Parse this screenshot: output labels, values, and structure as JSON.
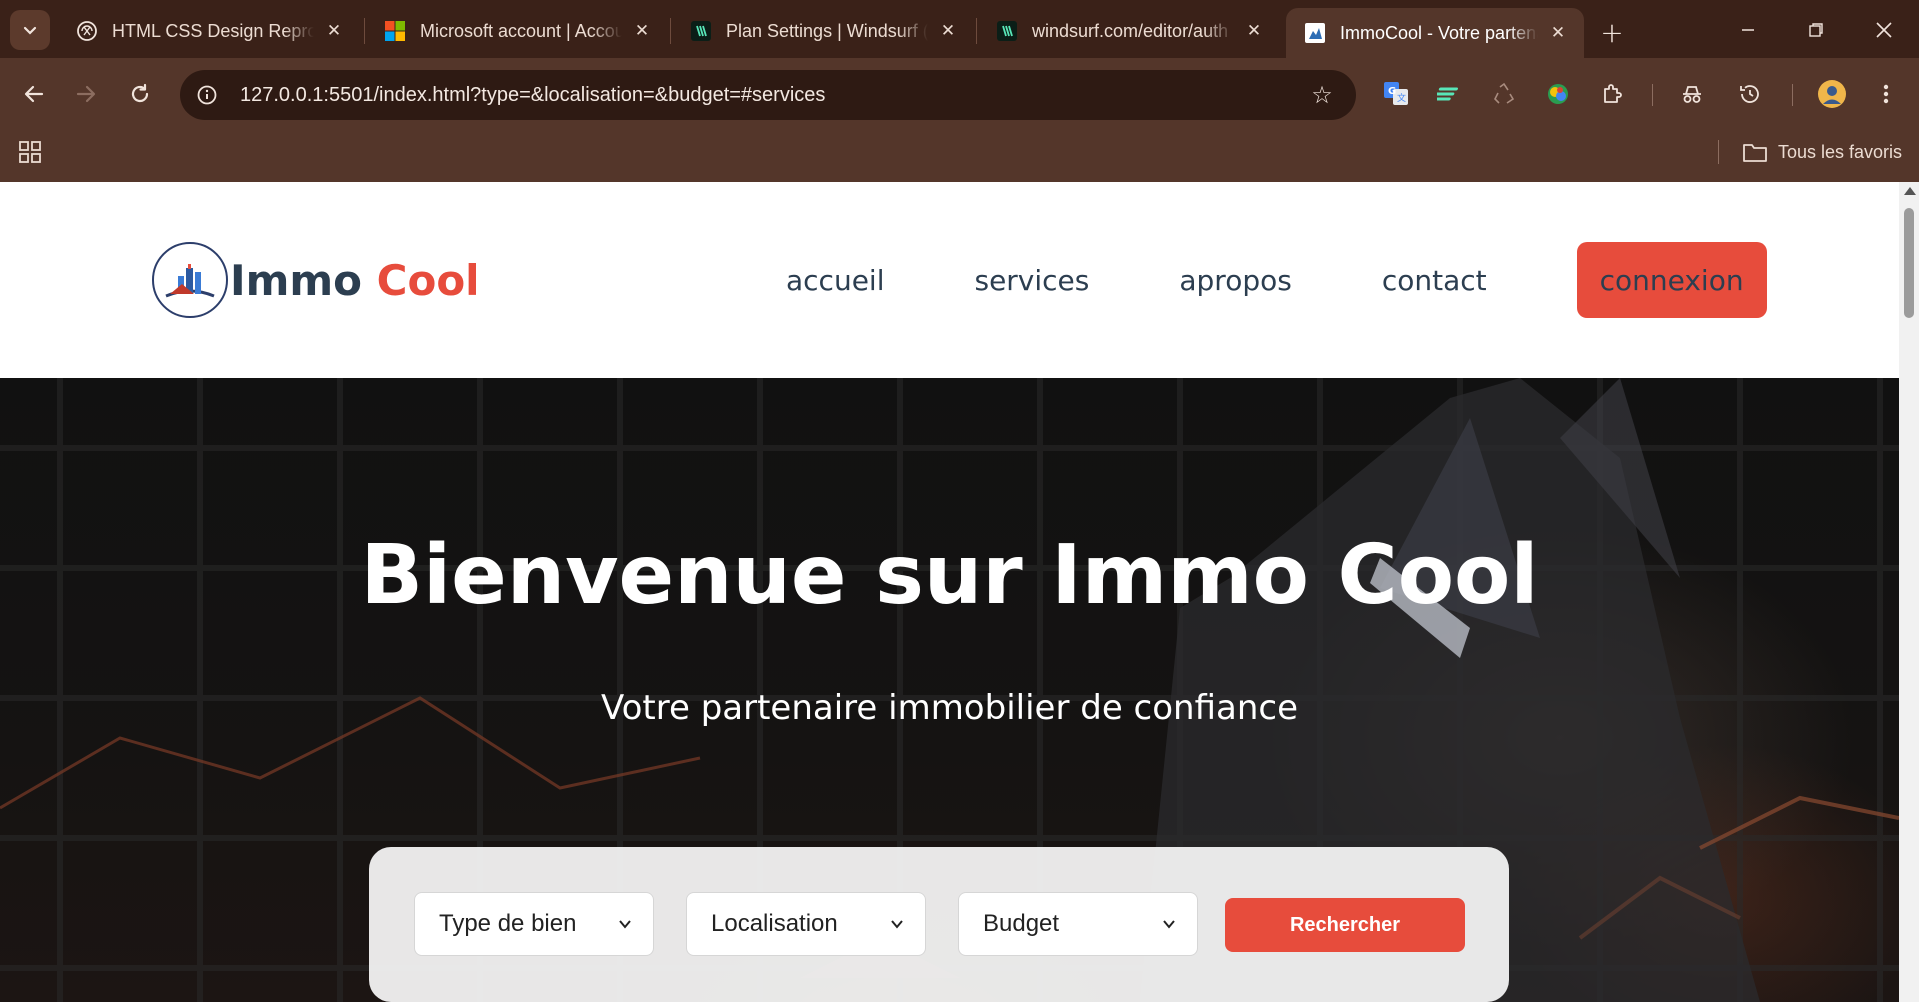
{
  "browser": {
    "tabs": [
      {
        "title": "HTML CSS Design Reproduction",
        "icon": "openai-icon"
      },
      {
        "title": "Microsoft account | Account",
        "icon": "microsoft-icon"
      },
      {
        "title": "Plan Settings | Windsurf (formerly Codeium)",
        "icon": "windsurf-icon"
      },
      {
        "title": "windsurf.com/editor/auth",
        "icon": "windsurf-icon"
      },
      {
        "title": "ImmoCool - Votre partenaire immobilier",
        "icon": "immocool-icon",
        "active": true
      }
    ],
    "url": "127.0.0.1:5501/index.html?type=&localisation=&budget=#services",
    "bookmarks_all_label": "Tous les favoris"
  },
  "site": {
    "logo": {
      "part1": "Immo ",
      "part2": "Cool"
    },
    "nav": [
      {
        "label": "accueil"
      },
      {
        "label": "services"
      },
      {
        "label": "apropos"
      },
      {
        "label": "contact"
      }
    ],
    "login_label": "connexion"
  },
  "hero": {
    "title": "Bienvenue sur Immo Cool",
    "subtitle": "Votre partenaire immobilier de confiance"
  },
  "search": {
    "type_select": "Type de bien",
    "location_select": "Localisation",
    "budget_select": "Budget",
    "button_label": "Rechercher"
  },
  "colors": {
    "accent": "#e74c3c",
    "text_dark": "#2c3e50",
    "chrome_bg": "#54362a"
  }
}
